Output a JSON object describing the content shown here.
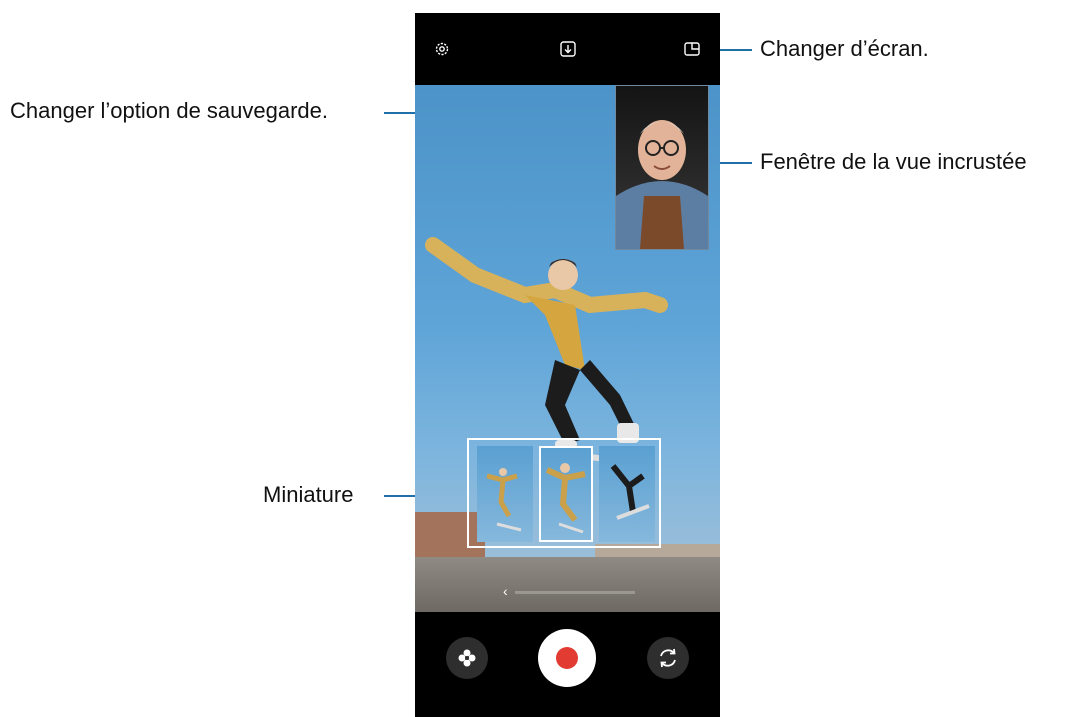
{
  "callouts": {
    "screen_change": "Changer d’écran.",
    "save_option": "Changer l’option de sauvegarde.",
    "pip_window": "Fenêtre de la vue incrustée",
    "thumbnail": "Miniature"
  },
  "icons": {
    "settings": "gear-icon",
    "save_option": "download-box-icon",
    "screen_change": "layout-icon",
    "effects": "flower-icon",
    "switch_camera": "rotate-icon",
    "back": "chevron-left-icon"
  },
  "viewfinder": {
    "chevron": "‹"
  },
  "colors": {
    "accent_line": "#1f6fa8",
    "record": "#e23b32",
    "sky": "#5ea4d7"
  }
}
